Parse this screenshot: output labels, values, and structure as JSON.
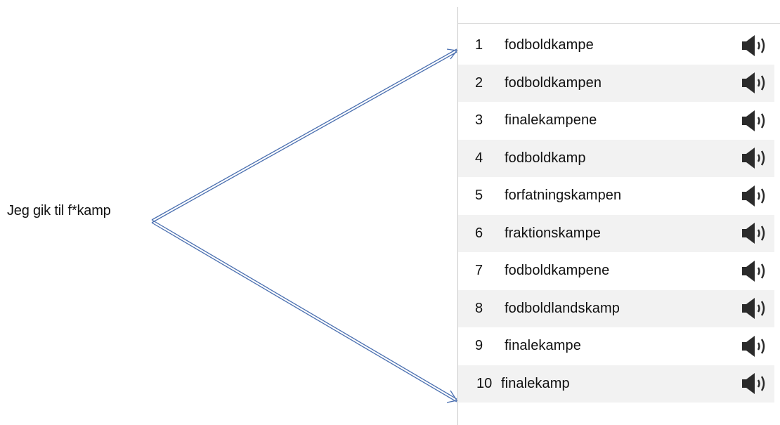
{
  "query": {
    "text": "Jeg gik til f*kamp"
  },
  "results": [
    {
      "number": "1",
      "word": "fodboldkampe",
      "icon": "speaker-icon"
    },
    {
      "number": "2",
      "word": "fodboldkampen",
      "icon": "speaker-icon"
    },
    {
      "number": "3",
      "word": "finalekampene",
      "icon": "speaker-icon"
    },
    {
      "number": "4",
      "word": "fodboldkamp",
      "icon": "speaker-icon"
    },
    {
      "number": "5",
      "word": "forfatningskampen",
      "icon": "speaker-icon"
    },
    {
      "number": "6",
      "word": "fraktionskampe",
      "icon": "speaker-icon"
    },
    {
      "number": "7",
      "word": "fodboldkampene",
      "icon": "speaker-icon"
    },
    {
      "number": "8",
      "word": "fodboldlandskamp",
      "icon": "speaker-icon"
    },
    {
      "number": "9",
      "word": "finalekampe",
      "icon": "speaker-icon"
    },
    {
      "number": "10",
      "word": "finalekamp",
      "icon": "speaker-icon"
    }
  ],
  "colors": {
    "arrow": "#4a6fb0",
    "alt_row": "#f2f2f2",
    "icon": "#2b2b2b",
    "divider": "#c8c8c8"
  }
}
